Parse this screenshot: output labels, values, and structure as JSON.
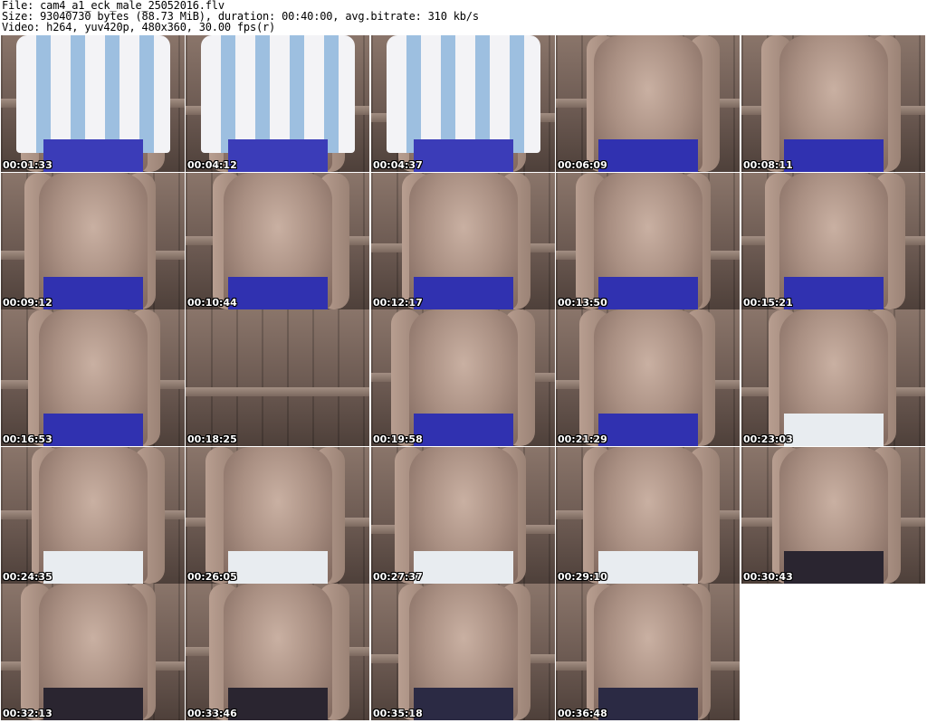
{
  "header": {
    "line1": "File: cam4_a1_eck_male_25052016.flv",
    "line2": "Size: 93040730 bytes (88.73 MiB), duration: 00:40:00, avg.bitrate: 310 kb/s",
    "line3": "Video: h264, yuv420p, 480x360, 30.00 fps(r)"
  },
  "thumbnails": [
    {
      "timestamp": "00:01:33",
      "scene": "shirt",
      "shorts": "#3b3cb8"
    },
    {
      "timestamp": "00:04:12",
      "scene": "shirt",
      "shorts": "#3b3cb8"
    },
    {
      "timestamp": "00:04:37",
      "scene": "shirt",
      "shorts": "#3b3cb8"
    },
    {
      "timestamp": "00:06:09",
      "scene": "bare",
      "shorts": "#3031b0"
    },
    {
      "timestamp": "00:08:11",
      "scene": "bare",
      "shorts": "#3031b0"
    },
    {
      "timestamp": "00:09:12",
      "scene": "bare",
      "shorts": "#3031b0"
    },
    {
      "timestamp": "00:10:44",
      "scene": "bare",
      "shorts": "#3031b0"
    },
    {
      "timestamp": "00:12:17",
      "scene": "bare",
      "shorts": "#3031b0"
    },
    {
      "timestamp": "00:13:50",
      "scene": "bare",
      "shorts": "#3031b0"
    },
    {
      "timestamp": "00:15:21",
      "scene": "bare",
      "shorts": "#3031b0"
    },
    {
      "timestamp": "00:16:53",
      "scene": "bare",
      "shorts": "#3031b0"
    },
    {
      "timestamp": "00:18:25",
      "scene": "empty",
      "shorts": ""
    },
    {
      "timestamp": "00:19:58",
      "scene": "bare",
      "shorts": "#3031b0"
    },
    {
      "timestamp": "00:21:29",
      "scene": "bare",
      "shorts": "#3031b0"
    },
    {
      "timestamp": "00:23:03",
      "scene": "bare",
      "shorts": "#e8ecf0"
    },
    {
      "timestamp": "00:24:35",
      "scene": "bare",
      "shorts": "#e8ecf0"
    },
    {
      "timestamp": "00:26:05",
      "scene": "bare",
      "shorts": "#e8ecf0"
    },
    {
      "timestamp": "00:27:37",
      "scene": "bare",
      "shorts": "#e8ecf0"
    },
    {
      "timestamp": "00:29:10",
      "scene": "bare",
      "shorts": "#e8ecf0"
    },
    {
      "timestamp": "00:30:43",
      "scene": "bare",
      "shorts": "#2a2530"
    },
    {
      "timestamp": "00:32:13",
      "scene": "bare",
      "shorts": "#2a2530"
    },
    {
      "timestamp": "00:33:46",
      "scene": "bare",
      "shorts": "#2a2530"
    },
    {
      "timestamp": "00:35:18",
      "scene": "bare",
      "shorts": "#2b2a44"
    },
    {
      "timestamp": "00:36:48",
      "scene": "bare",
      "shorts": "#2b2a44"
    }
  ]
}
